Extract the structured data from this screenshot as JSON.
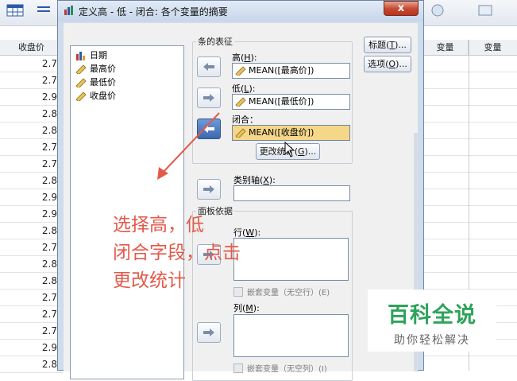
{
  "background": {
    "columns": [
      "收盘价",
      "变量",
      "变量"
    ],
    "close_values": [
      "2.7",
      "2.7",
      "2.9",
      "2.8",
      "2.8",
      "2.7",
      "2.7",
      "2.8",
      "2.9",
      "2.9",
      "2.8",
      "2.7",
      "2.8",
      "2.8",
      "2.7",
      "2.7",
      "2.7",
      "2.9",
      "2.8"
    ]
  },
  "dialog": {
    "title": "定义高 - 低 - 闭合: 各个变量的摘要",
    "close_label": "x",
    "variables": [
      "日期",
      "最高价",
      "最低价",
      "收盘价"
    ],
    "bar_group_label": "条的表征",
    "high": {
      "label": "高",
      "key": "H",
      "value": "MEAN([最高价])"
    },
    "low": {
      "label": "低",
      "key": "L",
      "value": "MEAN([最低价])"
    },
    "close": {
      "label": "闭合：",
      "value": "MEAN([收盘价])"
    },
    "change_stat": {
      "label": "更改统计",
      "key": "G"
    },
    "category_axis": {
      "label": "类别轴",
      "key": "X",
      "value": ""
    },
    "panel_group_label": "面板依据",
    "rows": {
      "label": "行",
      "key": "W"
    },
    "rows_nest": "嵌套变量（无空行）(E)",
    "columns": {
      "label": "列",
      "key": "M"
    },
    "cols_nest": "嵌套变量（无空列）(I)",
    "titles_button": {
      "label": "标题",
      "key": "T"
    },
    "options_button": {
      "label": "选项",
      "key": "O"
    }
  },
  "annotation": {
    "lines": [
      "选择高，低",
      "闭合字段，点击",
      "更改统计"
    ],
    "color": "#e25a4b"
  },
  "watermark": {
    "title": "百科全说",
    "subtitle": "助你轻松解决",
    "color": "#2ea35a"
  },
  "colors": {
    "highlight_field": "#f5d78a",
    "active_arrow": "#3b68b0",
    "dialog_frame": "#cfdcec"
  }
}
